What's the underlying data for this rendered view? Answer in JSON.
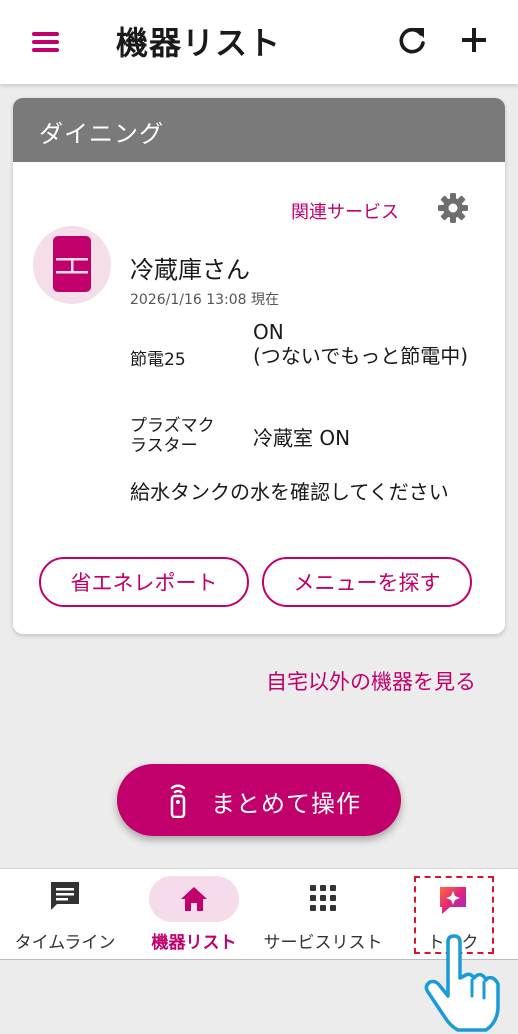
{
  "header": {
    "title": "機器リスト"
  },
  "room": {
    "name": "ダイニング",
    "related_services_label": "関連サービス"
  },
  "device": {
    "name": "冷蔵庫さん",
    "timestamp": "2026/1/16 13:08 現在",
    "statuses": [
      {
        "label": "節電25",
        "value": "ON\n(つないでもっと節電中)"
      },
      {
        "label": "プラズマクラスター",
        "value": "冷蔵室 ON"
      }
    ],
    "message": "給水タンクの水を確認してください",
    "buttons": {
      "energy_report": "省エネレポート",
      "find_menu": "メニューを探す"
    }
  },
  "other_devices_link": "自宅以外の機器を見る",
  "fab": {
    "label": "まとめて操作"
  },
  "bottom_nav": {
    "items": [
      {
        "label": "タイムライン",
        "icon": "chat-icon",
        "active": false
      },
      {
        "label": "機器リスト",
        "icon": "home-icon",
        "active": true
      },
      {
        "label": "サービスリスト",
        "icon": "grid-icon",
        "active": false
      },
      {
        "label": "トーク",
        "icon": "talk-icon",
        "active": false
      }
    ]
  },
  "colors": {
    "accent": "#c2006b",
    "room_header": "#7a7a7a",
    "highlight": "#e0102a"
  }
}
